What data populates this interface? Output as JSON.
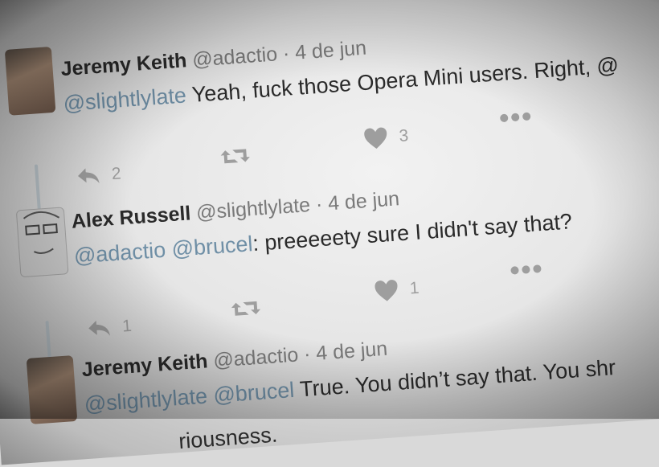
{
  "tweets": [
    {
      "name": "Jeremy Keith",
      "handle": "@adactio",
      "date": "· 4 de jun",
      "mentions": [
        "@slightlylate"
      ],
      "body": "Yeah, fuck those Opera Mini users. Right, @",
      "reply_count": "2",
      "like_count": "3"
    },
    {
      "name": "Alex Russell",
      "handle": "@slightlylate",
      "date": "· 4 de jun",
      "mentions": [
        "@adactio",
        "@brucel"
      ],
      "body": ": preeeeety sure I didn't say that?",
      "reply_count": "1",
      "like_count": "1"
    },
    {
      "name": "Jeremy Keith",
      "handle": "@adactio",
      "date": "· 4 de jun",
      "mentions": [
        "@slightlylate",
        "@brucel"
      ],
      "body": "True. You didn’t say that. You shr",
      "continuation": "riousness."
    }
  ],
  "icons": {
    "reply": "reply-icon",
    "retweet": "retweet-icon",
    "like": "heart-icon",
    "more": "more-icon"
  }
}
